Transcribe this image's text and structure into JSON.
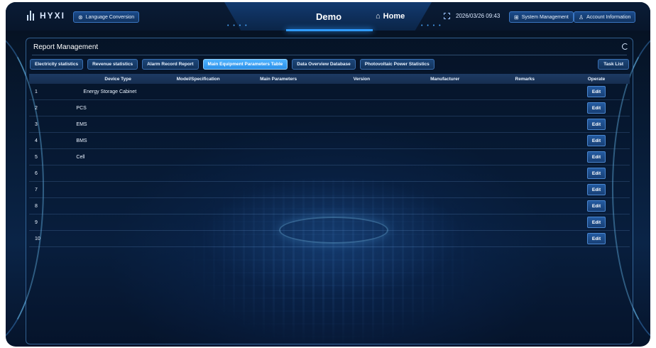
{
  "header": {
    "logo_text": "HYXI",
    "language_button": "Language Conversion",
    "title": "Demo",
    "home_label": "Home",
    "datetime": "2026/03/26 09:43",
    "system_button": "System Management",
    "account_button": "Account Information"
  },
  "panel": {
    "title": "Report Management",
    "task_list_button": "Task List",
    "tabs": [
      {
        "label": "Electricity statistics"
      },
      {
        "label": "Revenue statistics"
      },
      {
        "label": "Alarm Record Report"
      },
      {
        "label": "Main Equipment Parameters Table"
      },
      {
        "label": "Data Overview Database"
      },
      {
        "label": "Photovoltaic Power Statistics"
      }
    ],
    "active_tab": "Main Equipment Parameters Table"
  },
  "table": {
    "columns": [
      "Device Type",
      "Model/Specification",
      "Main Parameters",
      "Version",
      "Manufacturer",
      "Remarks",
      "Operate"
    ],
    "edit_label": "Edit",
    "rows": [
      {
        "no": "1",
        "device": "Energy Storage Cabinet"
      },
      {
        "no": "2",
        "device": "PCS"
      },
      {
        "no": "3",
        "device": "EMS"
      },
      {
        "no": "4",
        "device": "BMS"
      },
      {
        "no": "5",
        "device": "Cell"
      },
      {
        "no": "6",
        "device": ""
      },
      {
        "no": "7",
        "device": ""
      },
      {
        "no": "8",
        "device": ""
      },
      {
        "no": "9",
        "device": ""
      },
      {
        "no": "10",
        "device": ""
      }
    ]
  },
  "icons": {
    "language": "globe-icon",
    "home": "home-icon",
    "fullscreen": "fullscreen-icon",
    "system": "grid-icon",
    "account": "user-icon",
    "refresh": "refresh-icon"
  },
  "colors": {
    "accent": "#2f9bff",
    "active_tab": "#4fb3ff",
    "background": "#071a33"
  }
}
